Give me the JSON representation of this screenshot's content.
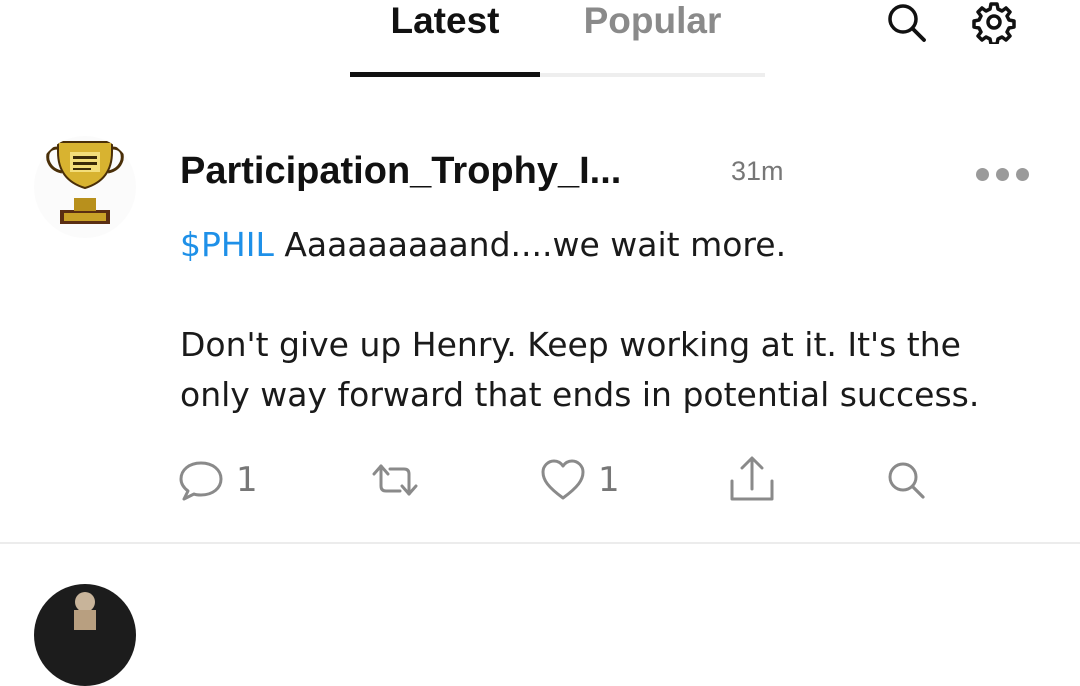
{
  "tabs": {
    "latest_label": "Latest",
    "popular_label": "Popular",
    "active": "Latest"
  },
  "header_icons": [
    "search-icon",
    "gear-icon"
  ],
  "post": {
    "username": "Participation_Trophy_I...",
    "time": "31m",
    "ticker": "$PHIL",
    "line1_rest": " Aaaaaaaaand....we wait more.",
    "line2": "Don't give up Henry. Keep working at it. It's the only way forward that ends in potential success.",
    "reply_count": "1",
    "like_count": "1",
    "avatar_icon": "trophy-icon"
  },
  "colors": {
    "ticker": "#1e90e8",
    "text": "#1a1a1a",
    "muted": "#777777",
    "active_tab": "#111111",
    "inactive_tab": "#8a8a8a"
  }
}
